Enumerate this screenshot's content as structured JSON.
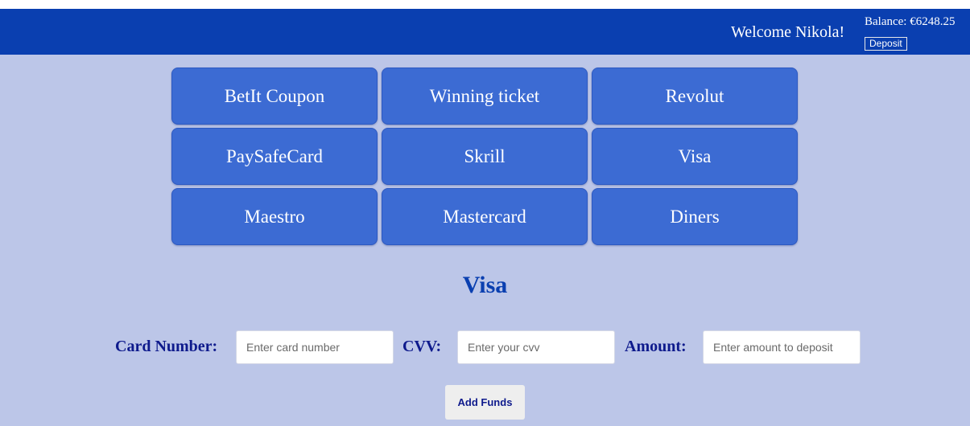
{
  "header": {
    "welcome_text": "Welcome Nikola!",
    "balance_text": "Balance: €6248.25",
    "deposit_label": "Deposit"
  },
  "payment_methods": [
    "BetIt Coupon",
    "Winning ticket",
    "Revolut",
    "PaySafeCard",
    "Skrill",
    "Visa",
    "Maestro",
    "Mastercard",
    "Diners"
  ],
  "selected_method_title": "Visa",
  "form": {
    "card_number_label": "Card Number:",
    "card_number_placeholder": "Enter card number",
    "cvv_label": "CVV:",
    "cvv_placeholder": "Enter your cvv",
    "amount_label": "Amount:",
    "amount_placeholder": "Enter amount to deposit",
    "submit_label": "Add Funds"
  },
  "colors": {
    "header_bg": "#0a3fb0",
    "page_bg": "#bcc6e8",
    "method_button": "#3c6bd3",
    "label_text": "#0e1a8c"
  }
}
